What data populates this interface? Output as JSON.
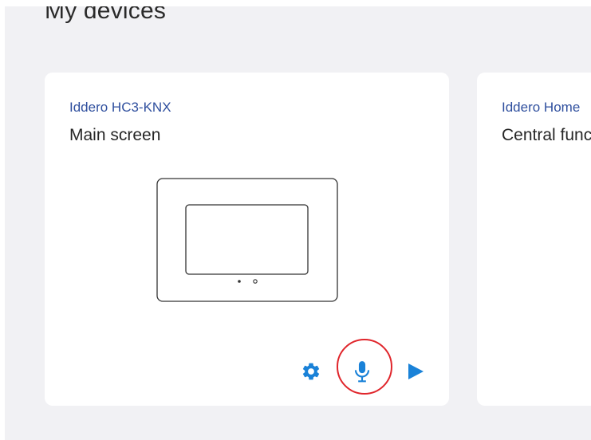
{
  "page": {
    "title": "My devices"
  },
  "devices": [
    {
      "brand": "Iddero HC3-KNX",
      "name": "Main screen",
      "actions": [
        "settings-icon",
        "microphone-icon",
        "play-icon"
      ]
    },
    {
      "brand": "Iddero Home",
      "name": "Central functions"
    }
  ],
  "colors": {
    "background": "#f1f1f4",
    "card": "#ffffff",
    "brand_text": "#2f4f9e",
    "accent_blue": "#1a82d8",
    "highlight": "#e0252b"
  }
}
